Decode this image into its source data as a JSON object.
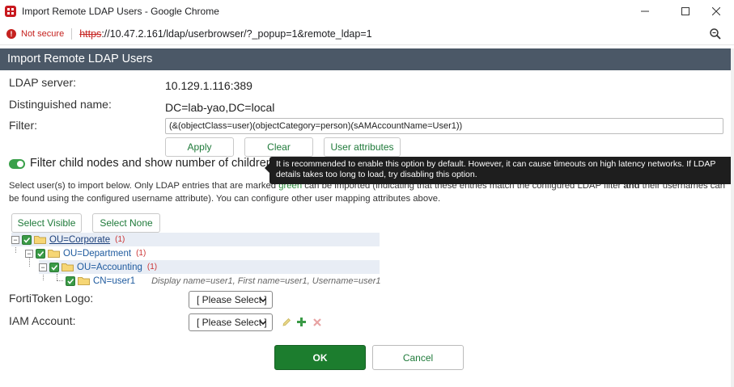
{
  "window": {
    "title": "Import Remote LDAP Users - Google Chrome",
    "url_protocol": "https",
    "url_rest": "://10.47.2.161/ldap/userbrowser/?_popup=1&remote_ldap=1",
    "security_label": "Not secure"
  },
  "page": {
    "header": "Import Remote LDAP Users",
    "ldap_server_label": "LDAP server:",
    "ldap_server_value": "10.129.1.116:389",
    "dn_label": "Distinguished name:",
    "dn_value": "DC=lab-yao,DC=local",
    "filter_label": "Filter:",
    "filter_value": "(&(objectClass=user)(objectCategory=person)(sAMAccountName=User1))",
    "buttons": {
      "apply": "Apply",
      "clear": "Clear",
      "user_attributes": "User attributes",
      "select_visible": "Select Visible",
      "select_none": "Select None",
      "ok": "OK",
      "cancel": "Cancel"
    },
    "toggle_label": "Filter child nodes and show number of children",
    "tooltip": "It is recommended to enable this option by default. However, it can cause timeouts on high latency networks. If LDAP details takes too long to load, try disabling this option.",
    "description": {
      "part1": "Select user(s) to import below. Only LDAP entries that are marked ",
      "green": "green",
      "part2": " can be imported (indicating that these entries match the configured LDAP filter ",
      "bold": "and",
      "part3": " their usernames can be found using the configured username attribute). You can configure other user mapping attributes above."
    },
    "tree": [
      {
        "name": "OU=Corporate",
        "count": "(1)"
      },
      {
        "name": "OU=Department",
        "count": "(1)"
      },
      {
        "name": "OU=Accounting",
        "count": "(1)"
      },
      {
        "name": "CN=user1",
        "extra": "Display name=user1, First name=user1, Username=user1"
      }
    ],
    "fortitoken_label": "FortiToken Logo:",
    "fortitoken_value": "[ Please Select ]",
    "iam_label": "IAM Account:",
    "iam_value": "[ Please Select ]"
  }
}
